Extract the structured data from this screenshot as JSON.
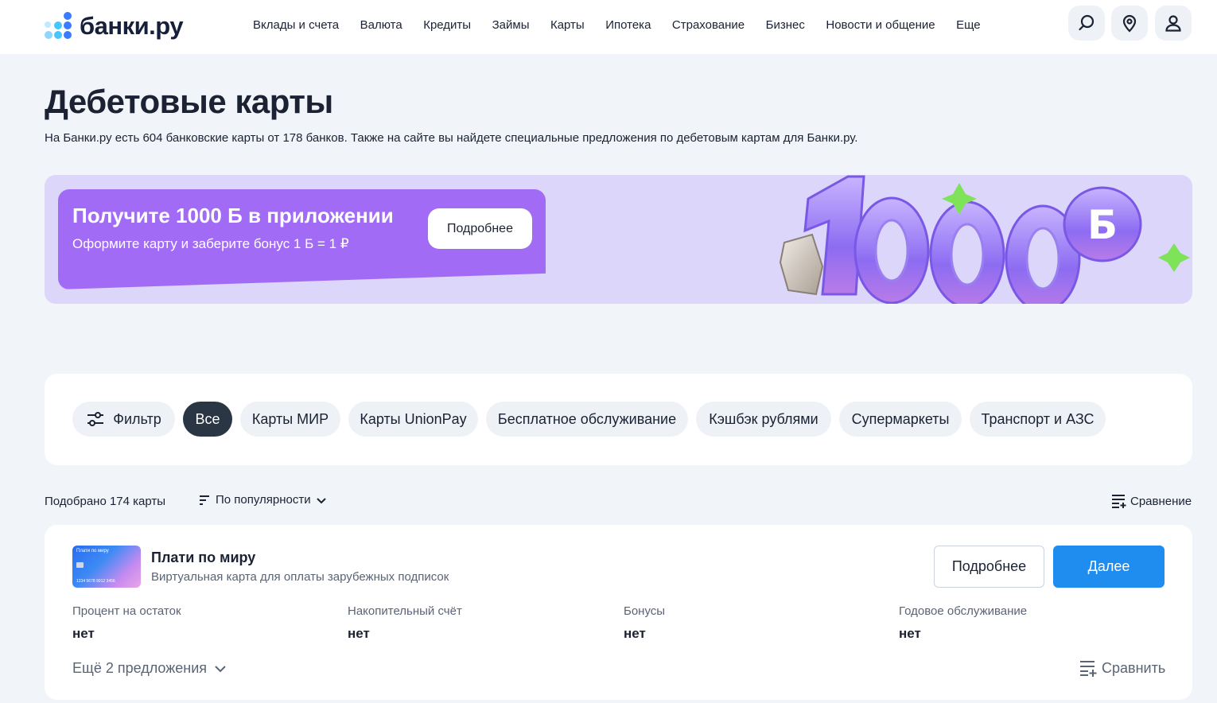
{
  "brand": {
    "name": "банки.ру",
    "dot_colors": [
      "#3a7bff",
      "#46c6ff",
      "#8fd6ff"
    ]
  },
  "nav": {
    "items": [
      "Вклады и счета",
      "Валюта",
      "Кредиты",
      "Займы",
      "Карты",
      "Ипотека",
      "Страхование",
      "Бизнес",
      "Новости и общение",
      "Еще"
    ]
  },
  "header_icons": [
    "search-icon",
    "location-pin-icon",
    "user-icon"
  ],
  "page": {
    "title": "Дебетовые карты",
    "subtitle": "На Банки.ру есть 604 банковские карты от 178 банков. Также на сайте вы найдете специальные предложения по дебетовым картам для Банки.ру."
  },
  "banner": {
    "title": "Получите 1000 Б в приложении",
    "text": "Оформите карту и заберите бонус 1 Б = 1 ₽",
    "button": "Подробнее",
    "art_number": "1000",
    "art_badge": "Б",
    "background": "#dcd6fb",
    "card_color": "#a26bf5"
  },
  "filters": {
    "filter_label": "Фильтр",
    "chips": [
      {
        "label": "Все",
        "active": true
      },
      {
        "label": "Карты МИР",
        "active": false
      },
      {
        "label": "Карты UnionPay",
        "active": false
      },
      {
        "label": "Бесплатное обслуживание",
        "active": false
      },
      {
        "label": "Кэшбэк рублями",
        "active": false
      },
      {
        "label": "Супермаркеты",
        "active": false
      },
      {
        "label": "Транспорт и АЗС",
        "active": false
      }
    ]
  },
  "results": {
    "found": "Подобрано 174 карты",
    "sort_label": "По популярности",
    "compare_label": "Сравнение"
  },
  "item": {
    "title": "Плати по миру",
    "subtitle": "Виртуальная карта для оплаты зарубежных подписок",
    "card_image_text": "Плати по миру",
    "card_number": "1234 5678 9012 3456",
    "more_button": "Подробнее",
    "next_button": "Далее",
    "params": [
      {
        "label": "Процент на остаток",
        "value": "нет"
      },
      {
        "label": "Накопительный счёт",
        "value": "нет"
      },
      {
        "label": "Бонусы",
        "value": "нет"
      },
      {
        "label": "Годовое обслуживание",
        "value": "нет"
      }
    ],
    "more_offers": "Ещё 2 предложения",
    "compare": "Сравнить",
    "accent": "#1f8df0"
  }
}
